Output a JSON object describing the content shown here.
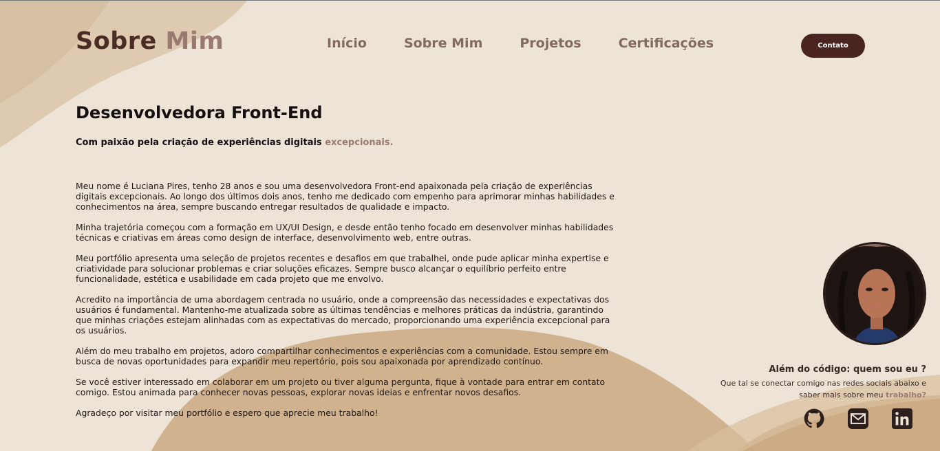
{
  "brand": {
    "part1": "Sobre",
    "part2": "Mim"
  },
  "nav": {
    "items": [
      {
        "label": "Início"
      },
      {
        "label": "Sobre Mim"
      },
      {
        "label": "Projetos"
      },
      {
        "label": "Certificações"
      }
    ],
    "contact_label": "Contato"
  },
  "hero": {
    "title": "Desenvolvedora Front-End",
    "tagline_main": "Com paixão pela criação de experiências digitais",
    "tagline_accent": "excepcionais."
  },
  "bio": {
    "paragraphs": [
      "Meu nome é Luciana Pires, tenho 28 anos e sou uma desenvolvedora Front-end apaixonada pela criação de experiências digitais excepcionais. Ao longo dos últimos dois anos, tenho me dedicado com empenho para aprimorar minhas habilidades e conhecimentos na área, sempre buscando entregar resultados de qualidade e impacto.",
      "Minha trajetória começou com a formação em UX/UI Design, e desde então tenho focado em desenvolver minhas habilidades técnicas e criativas em áreas como design de interface, desenvolvimento web, entre outras.",
      "Meu portfólio apresenta uma seleção de projetos recentes e desafios em que trabalhei, onde pude aplicar minha expertise e criatividade para solucionar problemas e criar soluções eficazes. Sempre busco alcançar o equilíbrio perfeito entre funcionalidade, estética e usabilidade em cada projeto que me envolvo.",
      "Acredito na importância de uma abordagem centrada no usuário, onde a compreensão das necessidades e expectativas dos usuários é fundamental. Mantenho-me atualizada sobre as últimas tendências e melhores práticas da indústria, garantindo que minhas criações estejam alinhadas com as expectativas do mercado, proporcionando uma experiência excepcional para os usuários.",
      "Além do meu trabalho em projetos, adoro compartilhar conhecimentos e experiências com a comunidade. Estou sempre em busca de novas oportunidades para expandir meu repertório, pois sou apaixonada por aprendizado contínuo.",
      "Se você estiver interessado em colaborar em um projeto ou tiver alguma pergunta, fique à vontade para entrar em contato comigo. Estou animada para conhecer novas pessoas, explorar novas ideias e enfrentar novos desafios.",
      "Agradeço por visitar meu portfólio e espero que aprecie meu trabalho!"
    ]
  },
  "aside": {
    "title": "Além do código: quem sou eu ?",
    "text": "Que tal se conectar comigo nas redes sociais abaixo e saber mais sobre meu",
    "text_accent": "trabalho?",
    "socials": [
      {
        "icon": "github-icon"
      },
      {
        "icon": "email-icon"
      },
      {
        "icon": "linkedin-icon"
      }
    ]
  },
  "colors": {
    "background": "#ede3d6",
    "brand_dark": "#4a2c24",
    "accent": "#9a7a70",
    "button": "#4a2420",
    "nav": "#836a62"
  }
}
